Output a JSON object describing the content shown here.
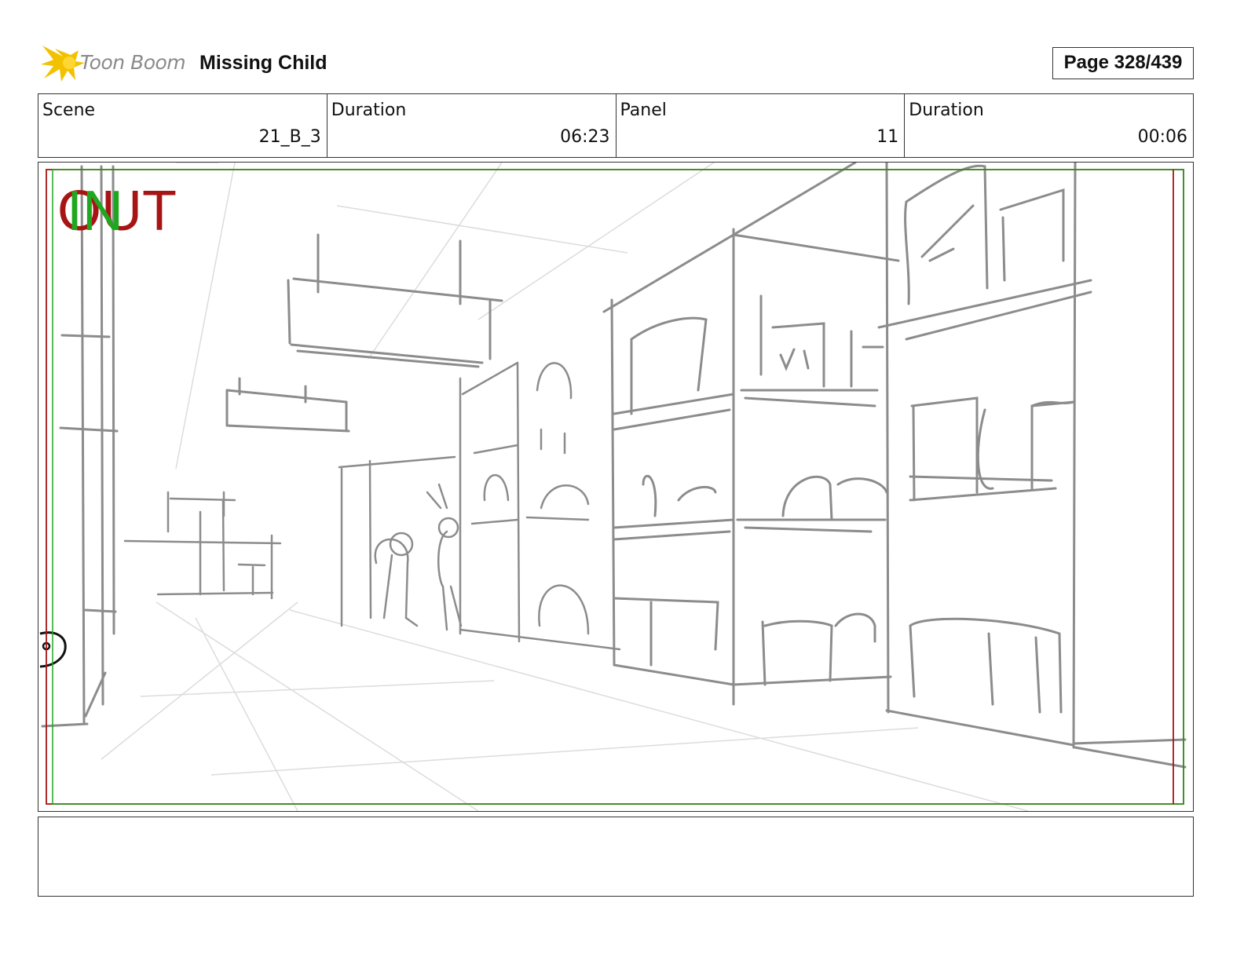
{
  "header": {
    "logo_text": "Toon Boom",
    "project_title": "Missing Child",
    "page_label": "Page 328/439"
  },
  "info": {
    "scene_label": "Scene",
    "scene_value": "21_B_3",
    "scene_duration_label": "Duration",
    "scene_duration_value": "06:23",
    "panel_label": "Panel",
    "panel_value": "11",
    "panel_duration_label": "Duration",
    "panel_duration_value": "00:06"
  },
  "panel": {
    "in_marker": "IN",
    "out_marker": "OUT"
  },
  "notes": {
    "text": ""
  },
  "colors": {
    "in_marker": "#1fa81f",
    "out_marker": "#a71414",
    "safe_frame_red": "#a71414",
    "safe_frame_green": "#1fa81f",
    "sketch_gray": "#8c8c8c",
    "logo_yellow": "#f2c200"
  }
}
